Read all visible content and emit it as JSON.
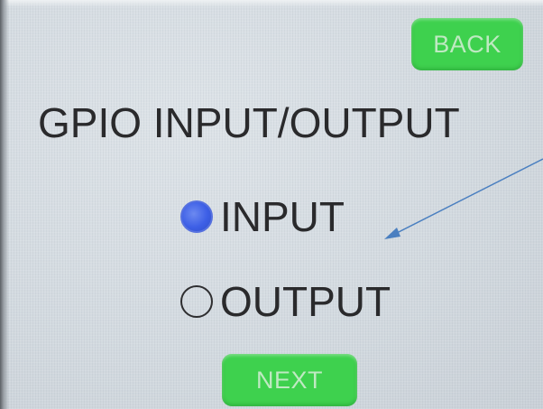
{
  "header": {
    "back_label": "BACK"
  },
  "main": {
    "title": "GPIO INPUT/OUTPUT",
    "options": [
      {
        "label": "INPUT",
        "selected": true
      },
      {
        "label": "OUTPUT",
        "selected": false
      }
    ]
  },
  "footer": {
    "next_label": "NEXT"
  },
  "colors": {
    "button_green": "#3ed14e",
    "radio_selected_blue": "#3d5fe6",
    "annotation_arrow": "#4a7fc0"
  },
  "annotation": {
    "icon": "arrow-pointer-icon"
  }
}
